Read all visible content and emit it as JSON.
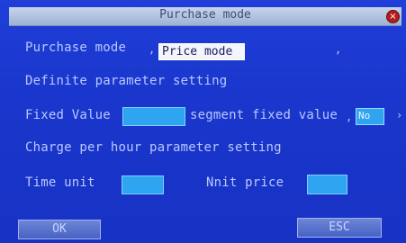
{
  "window": {
    "title": "Purchase mode",
    "close_icon": "close-icon"
  },
  "form": {
    "purchase_mode_label": "Purchase mode",
    "purchase_mode_value": "Price mode",
    "definite_header": "Definite parameter setting",
    "fixed_value_label": "Fixed Value",
    "fixed_value": "",
    "segment_label": "segment fixed value",
    "segment_value": "No",
    "charge_header": "Charge per hour parameter setting",
    "time_unit_label": "Time unit",
    "time_unit_value": "",
    "unit_price_label": "Nnit price",
    "unit_price_value": ""
  },
  "buttons": {
    "ok": "OK",
    "esc": "ESC"
  }
}
